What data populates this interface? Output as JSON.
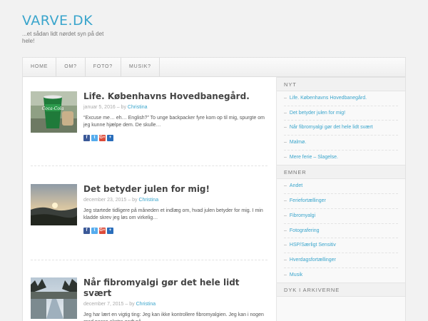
{
  "site": {
    "title": "VARVE.DK",
    "description": "...et sådan lidt nørdet syn på det hele!"
  },
  "nav": {
    "items": [
      {
        "label": "HOME"
      },
      {
        "label": "OM?"
      },
      {
        "label": "FOTO?"
      },
      {
        "label": "MUSIK?"
      }
    ]
  },
  "posts": [
    {
      "title": "Life. Københavns Hovedbanegård.",
      "date": "januar 5, 2016",
      "by": "– by",
      "author": "Christina",
      "excerpt": "“Excuse me… eh… English?” To unge backpacker fyre kom op til mig, spurgte om jeg kunne hjælpe dem. De skulle…",
      "thumb": "coca-cola-cup-photo"
    },
    {
      "title": "Det betyder julen for mig!",
      "date": "december 23, 2015",
      "by": "– by",
      "author": "Christina",
      "excerpt": "Jeg startede tidligere på måneden et indlæg om, hvad julen betyder for mig. I min kladde skrev jeg løs om virkelig…",
      "thumb": "sunset-landscape-photo"
    },
    {
      "title": "Når fibromyalgi gør det hele lidt svært",
      "date": "december 7, 2015",
      "by": "– by",
      "author": "Christina",
      "excerpt": "Jeg har lært en vigtig ting: Jeg kan ikke kontrollere fibromyalgien. Jeg kan i nogen grad passe ekstra godt på…",
      "thumb": "winter-path-photo"
    }
  ],
  "share": {
    "facebook": "f",
    "twitter": "t",
    "googleplus": "G+",
    "add": "+"
  },
  "sidebar": {
    "dash": "–",
    "nyt": {
      "title": "NYT",
      "items": [
        "Life. Københavns Hovedbanegård.",
        "Det betyder julen for mig!",
        "Når fibromyalgi gør det hele lidt svært",
        "Malmø.",
        "Mere ferie – Slagelse."
      ]
    },
    "emner": {
      "title": "EMNER",
      "items": [
        "Andet",
        "Feriefortællinger",
        "Fibromyalgi",
        "Fotografering",
        "HSP/Særligt Sensitiv",
        "Hverdagsfortællinger",
        "Musik"
      ]
    },
    "arkiv": {
      "title": "DYK I ARKIVERNE"
    }
  },
  "colors": {
    "accent": "#3aa5cc",
    "background": "#f2f2f2"
  }
}
